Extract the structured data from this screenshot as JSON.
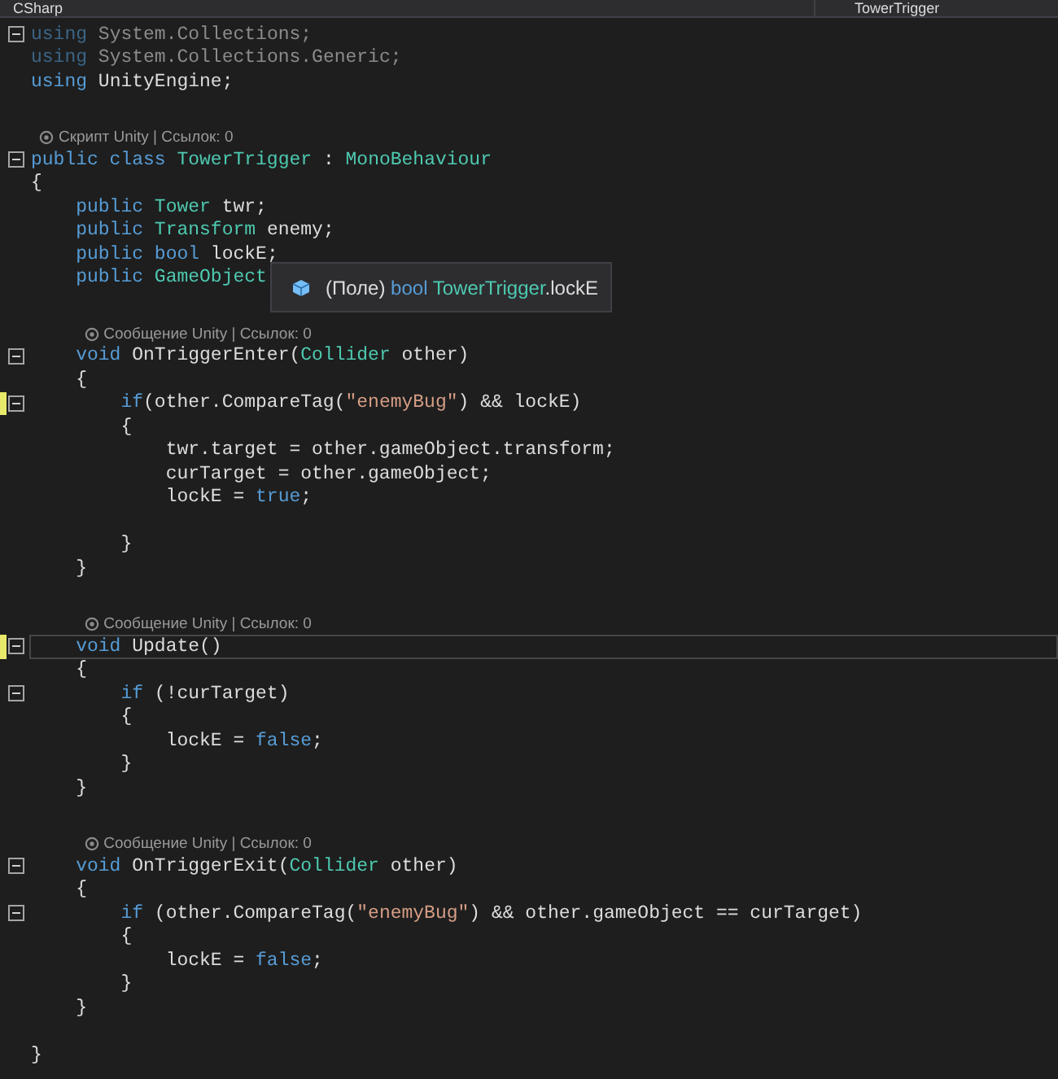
{
  "top_bar": {
    "project": "CSharp",
    "member_dropdown": "TowerTrigger"
  },
  "lines": [
    {
      "kind": "code",
      "fold": true,
      "changed": false,
      "current": false,
      "unused": true,
      "tokens": [
        {
          "kind": "kw",
          "text": "using "
        },
        {
          "kind": "plain",
          "text": "System.Collections;"
        }
      ]
    },
    {
      "kind": "code",
      "fold": false,
      "changed": false,
      "current": false,
      "unused": true,
      "tokens": [
        {
          "kind": "kw",
          "text": "using "
        },
        {
          "kind": "plain",
          "text": "System.Collections.Generic;"
        }
      ]
    },
    {
      "kind": "code",
      "fold": false,
      "changed": false,
      "current": false,
      "unused": false,
      "tokens": [
        {
          "kind": "kw",
          "text": "using "
        },
        {
          "kind": "plain",
          "text": "UnityEngine;"
        }
      ]
    },
    {
      "kind": "blank"
    },
    {
      "kind": "lens",
      "text": "Скрипт Unity | Ссылок: 0"
    },
    {
      "kind": "code",
      "fold": true,
      "changed": false,
      "current": false,
      "unused": false,
      "tokens": [
        {
          "kind": "kw",
          "text": "public class "
        },
        {
          "kind": "type",
          "text": "TowerTrigger"
        },
        {
          "kind": "plain",
          "text": " : "
        },
        {
          "kind": "type",
          "text": "MonoBehaviour"
        }
      ]
    },
    {
      "kind": "code",
      "fold": false,
      "changed": false,
      "current": false,
      "unused": false,
      "tokens": [
        {
          "kind": "plain",
          "text": "{"
        }
      ]
    },
    {
      "kind": "code",
      "fold": false,
      "changed": false,
      "current": false,
      "unused": false,
      "tokens": [
        {
          "kind": "kw",
          "text": "    public "
        },
        {
          "kind": "type",
          "text": "Tower"
        },
        {
          "kind": "plain",
          "text": " twr;"
        }
      ]
    },
    {
      "kind": "code",
      "fold": false,
      "changed": false,
      "current": false,
      "unused": false,
      "tokens": [
        {
          "kind": "kw",
          "text": "    public "
        },
        {
          "kind": "type",
          "text": "Transform"
        },
        {
          "kind": "plain",
          "text": " enemy;"
        }
      ]
    },
    {
      "kind": "code",
      "fold": false,
      "changed": false,
      "current": false,
      "unused": false,
      "tokens": [
        {
          "kind": "kw",
          "text": "    public bool"
        },
        {
          "kind": "plain",
          "text": " lockE;"
        }
      ]
    },
    {
      "kind": "code",
      "fold": false,
      "changed": false,
      "current": false,
      "unused": false,
      "tokens": [
        {
          "kind": "kw",
          "text": "    public "
        },
        {
          "kind": "type",
          "text": "GameObject"
        }
      ]
    },
    {
      "kind": "blank"
    },
    {
      "kind": "lens",
      "text": "Сообщение Unity | Ссылок: 0"
    },
    {
      "kind": "code",
      "fold": true,
      "changed": false,
      "current": false,
      "unused": false,
      "tokens": [
        {
          "kind": "kw",
          "text": "    void"
        },
        {
          "kind": "plain",
          "text": " OnTriggerEnter("
        },
        {
          "kind": "type",
          "text": "Collider"
        },
        {
          "kind": "plain",
          "text": " other)"
        }
      ]
    },
    {
      "kind": "code",
      "fold": false,
      "changed": false,
      "current": false,
      "unused": false,
      "tokens": [
        {
          "kind": "plain",
          "text": "    {"
        }
      ]
    },
    {
      "kind": "code",
      "fold": true,
      "changed": true,
      "current": false,
      "unused": false,
      "tokens": [
        {
          "kind": "kw",
          "text": "        if"
        },
        {
          "kind": "plain",
          "text": "(other.CompareTag("
        },
        {
          "kind": "str",
          "text": "\"enemyBug\""
        },
        {
          "kind": "plain",
          "text": ") && lockE)"
        }
      ]
    },
    {
      "kind": "code",
      "fold": false,
      "changed": false,
      "current": false,
      "unused": false,
      "tokens": [
        {
          "kind": "plain",
          "text": "        {"
        }
      ]
    },
    {
      "kind": "code",
      "fold": false,
      "changed": false,
      "current": false,
      "unused": false,
      "tokens": [
        {
          "kind": "plain",
          "text": "            twr.target = other.gameObject.transform;"
        }
      ]
    },
    {
      "kind": "code",
      "fold": false,
      "changed": false,
      "current": false,
      "unused": false,
      "tokens": [
        {
          "kind": "plain",
          "text": "            curTarget = other.gameObject;"
        }
      ]
    },
    {
      "kind": "code",
      "fold": false,
      "changed": false,
      "current": false,
      "unused": false,
      "tokens": [
        {
          "kind": "plain",
          "text": "            lockE = "
        },
        {
          "kind": "kw",
          "text": "true"
        },
        {
          "kind": "plain",
          "text": ";"
        }
      ]
    },
    {
      "kind": "blank"
    },
    {
      "kind": "code",
      "fold": false,
      "changed": false,
      "current": false,
      "unused": false,
      "tokens": [
        {
          "kind": "plain",
          "text": "        }"
        }
      ]
    },
    {
      "kind": "code",
      "fold": false,
      "changed": false,
      "current": false,
      "unused": false,
      "tokens": [
        {
          "kind": "plain",
          "text": "    }"
        }
      ]
    },
    {
      "kind": "blank"
    },
    {
      "kind": "lens",
      "text": "Сообщение Unity | Ссылок: 0"
    },
    {
      "kind": "code",
      "fold": true,
      "changed": true,
      "current": true,
      "unused": false,
      "tokens": [
        {
          "kind": "kw",
          "text": "    void"
        },
        {
          "kind": "plain",
          "text": " Update()"
        }
      ]
    },
    {
      "kind": "code",
      "fold": false,
      "changed": false,
      "current": false,
      "unused": false,
      "tokens": [
        {
          "kind": "plain",
          "text": "    {"
        }
      ]
    },
    {
      "kind": "code",
      "fold": true,
      "changed": false,
      "current": false,
      "unused": false,
      "tokens": [
        {
          "kind": "kw",
          "text": "        if"
        },
        {
          "kind": "plain",
          "text": " (!curTarget)"
        }
      ]
    },
    {
      "kind": "code",
      "fold": false,
      "changed": false,
      "current": false,
      "unused": false,
      "tokens": [
        {
          "kind": "plain",
          "text": "        {"
        }
      ]
    },
    {
      "kind": "code",
      "fold": false,
      "changed": false,
      "current": false,
      "unused": false,
      "tokens": [
        {
          "kind": "plain",
          "text": "            lockE = "
        },
        {
          "kind": "kw",
          "text": "false"
        },
        {
          "kind": "plain",
          "text": ";"
        }
      ]
    },
    {
      "kind": "code",
      "fold": false,
      "changed": false,
      "current": false,
      "unused": false,
      "tokens": [
        {
          "kind": "plain",
          "text": "        }"
        }
      ]
    },
    {
      "kind": "code",
      "fold": false,
      "changed": false,
      "current": false,
      "unused": false,
      "tokens": [
        {
          "kind": "plain",
          "text": "    }"
        }
      ]
    },
    {
      "kind": "blank"
    },
    {
      "kind": "lens",
      "text": "Сообщение Unity | Ссылок: 0"
    },
    {
      "kind": "code",
      "fold": true,
      "changed": false,
      "current": false,
      "unused": false,
      "tokens": [
        {
          "kind": "kw",
          "text": "    void"
        },
        {
          "kind": "plain",
          "text": " OnTriggerExit("
        },
        {
          "kind": "type",
          "text": "Collider"
        },
        {
          "kind": "plain",
          "text": " other)"
        }
      ]
    },
    {
      "kind": "code",
      "fold": false,
      "changed": false,
      "current": false,
      "unused": false,
      "tokens": [
        {
          "kind": "plain",
          "text": "    {"
        }
      ]
    },
    {
      "kind": "code",
      "fold": true,
      "changed": false,
      "current": false,
      "unused": false,
      "tokens": [
        {
          "kind": "kw",
          "text": "        if"
        },
        {
          "kind": "plain",
          "text": " (other.CompareTag("
        },
        {
          "kind": "str",
          "text": "\"enemyBug\""
        },
        {
          "kind": "plain",
          "text": ") && other.gameObject == curTarget)"
        }
      ]
    },
    {
      "kind": "code",
      "fold": false,
      "changed": false,
      "current": false,
      "unused": false,
      "tokens": [
        {
          "kind": "plain",
          "text": "        {"
        }
      ]
    },
    {
      "kind": "code",
      "fold": false,
      "changed": false,
      "current": false,
      "unused": false,
      "tokens": [
        {
          "kind": "plain",
          "text": "            lockE = "
        },
        {
          "kind": "kw",
          "text": "false"
        },
        {
          "kind": "plain",
          "text": ";"
        }
      ]
    },
    {
      "kind": "code",
      "fold": false,
      "changed": false,
      "current": false,
      "unused": false,
      "tokens": [
        {
          "kind": "plain",
          "text": "        }"
        }
      ]
    },
    {
      "kind": "code",
      "fold": false,
      "changed": false,
      "current": false,
      "unused": false,
      "tokens": [
        {
          "kind": "plain",
          "text": "    }"
        }
      ]
    },
    {
      "kind": "blank"
    },
    {
      "kind": "code",
      "fold": false,
      "changed": false,
      "current": false,
      "unused": false,
      "tokens": [
        {
          "kind": "plain",
          "text": "}"
        }
      ]
    }
  ],
  "tooltip": {
    "tokens": [
      {
        "kind": "plain",
        "text": "(Поле) "
      },
      {
        "kind": "kw",
        "text": "bool "
      },
      {
        "kind": "type",
        "text": "TowerTrigger"
      },
      {
        "kind": "plain",
        "text": ".lockE"
      }
    ]
  }
}
